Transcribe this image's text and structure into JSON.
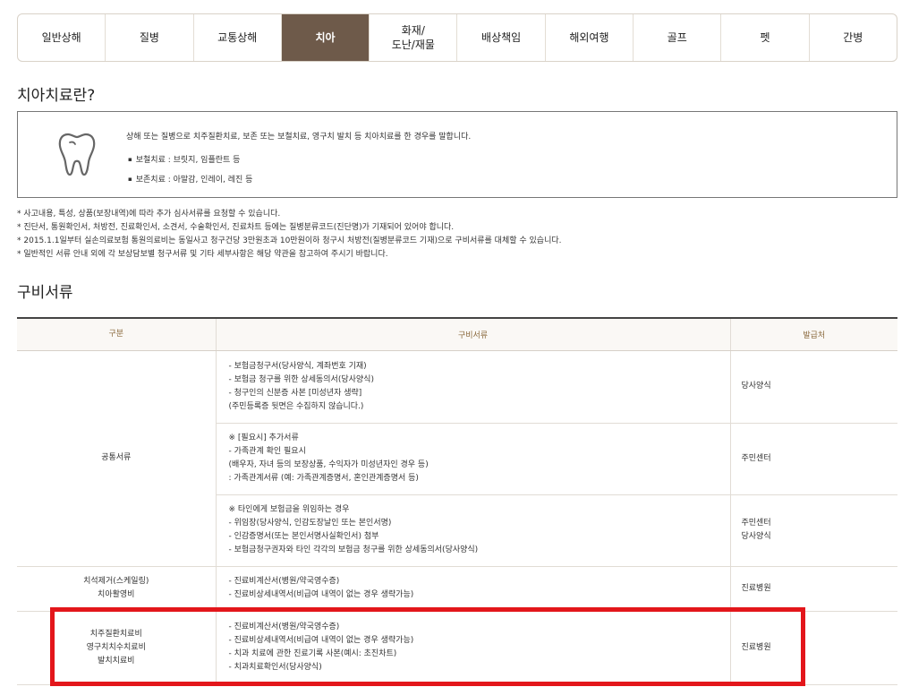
{
  "tabs": [
    {
      "label": "일반상해"
    },
    {
      "label": "질병"
    },
    {
      "label": "교통상해"
    },
    {
      "label": "치아",
      "active": true
    },
    {
      "label": "화재/\n도난/재물"
    },
    {
      "label": "배상책임"
    },
    {
      "label": "해외여행"
    },
    {
      "label": "골프"
    },
    {
      "label": "펫"
    },
    {
      "label": "간병"
    }
  ],
  "treatment": {
    "title": "치아치료란?",
    "icon": "tooth-icon",
    "description": "상해 또는 질병으로 치주질환치료, 보존 또는 보철치료, 영구치 발치 등 치아치료를 한 경우를 말합니다.",
    "bullets": [
      "보철치료 : 브릿지, 임플란트 등",
      "보존치료 : 아말감, 인레이, 레진 등"
    ]
  },
  "notes": [
    "* 사고내용, 특성, 상품(보장내역)에 따라 추가 심사서류를 요청할 수 있습니다.",
    "* 진단서, 통원확인서, 처방전, 진료확인서, 소견서, 수술확인서, 진료차트 등에는 질병분류코드(진단명)가 기재되어 있어야 합니다.",
    "* 2015.1.1일부터 실손의료보험 통원의료비는 동일사고 청구건당 3만원초과 10만원이하 청구시 처방전(질병분류코드 기재)으로 구비서류를 대체할 수 있습니다.",
    "* 일반적인 서류 안내 외에 각 보상담보별 청구서류 및 기타 세부사항은 해당 약관을 참고하여 주시기 바랍니다."
  ],
  "docs": {
    "title": "구비서류",
    "headers": {
      "category": "구분",
      "documents": "구비서류",
      "issuer": "발급처"
    },
    "rows": [
      {
        "category": "공통서류",
        "documents": [
          "- 보험금청구서(당사양식, 계좌번호 기재)",
          "- 보험금 청구를 위한 상세동의서(당사양식)",
          "- 청구인의 신분증 사본 [미성년자 생략]",
          "(주민등록증 뒷면은 수집하지 않습니다.)"
        ],
        "issuer": [
          "당사양식"
        ]
      },
      {
        "documents": [
          "※ [필요시] 추가서류",
          "- 가족관계 확인 필요시",
          "(배우자, 자녀 등의 보장상품, 수익자가 미성년자인 경우 등)",
          ": 가족관계서류 (예: 가족관계증명서, 혼인관계증명서 등)"
        ],
        "issuer": [
          "주민센터"
        ]
      },
      {
        "documents": [
          "※ 타인에게 보험금을 위임하는 경우",
          "- 위임장(당사양식, 인감도장날인 또는 본인서명)",
          "- 인감증명서(또는 본인서명사실확인서) 첨부",
          "- 보험금청구권자와 타인 각각의 보험금 청구를 위한 상세동의서(당사양식)"
        ],
        "issuer": [
          "주민센터",
          "당사양식"
        ]
      },
      {
        "category": [
          "치석제거(스케일링)",
          "치아활영비"
        ],
        "documents": [
          "- 진료비계산서(병원/약국영수증)",
          "- 진료비상세내역서(비급여 내역이 없는 경우 생략가능)"
        ],
        "issuer": [
          "진료병원"
        ]
      },
      {
        "category": [
          "치주질환치료비",
          "영구치치수치료비",
          "발치치료비"
        ],
        "documents": [
          "- 진료비계산서(병원/약국영수증)",
          "- 진료비상세내역서(비급여 내역이 없는 경우 생략가능)",
          "- 치과 치료에 관한 진료기록 사본(예시: 초진차트)",
          "- 치과치료확인서(당사양식)"
        ],
        "issuer": [
          "진료병원"
        ]
      }
    ]
  },
  "colors": {
    "active_tab": "#6e5a4a",
    "highlight": "#e3161b",
    "header_text": "#8b6a3e"
  }
}
